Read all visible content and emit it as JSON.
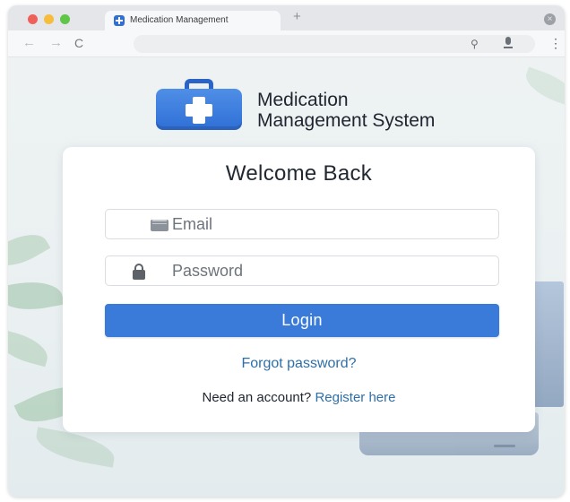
{
  "browser": {
    "tab_title": "Medication Management",
    "new_tab": "+",
    "close_window": "×",
    "back": "←",
    "forward": "→",
    "reload": "C",
    "search_glyph": "⚲",
    "menu_dots": "⋮"
  },
  "brand": {
    "line1": "Medication",
    "line2": "Management System",
    "logo_color": "#2f6fd6"
  },
  "login": {
    "title": "Welcome Back",
    "email_placeholder": "Email",
    "password_placeholder": "Password",
    "submit_label": "Login",
    "forgot_link": "Forgot password?",
    "register_prompt": "Need an account?",
    "register_link": "Register here",
    "accent_color": "#3a7bd9"
  }
}
